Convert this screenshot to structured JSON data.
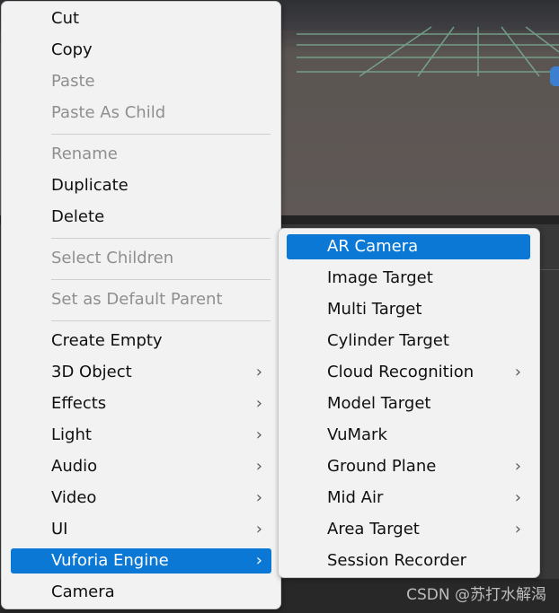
{
  "main_menu": {
    "items": [
      {
        "label": "Cut",
        "state": "enabled",
        "submenu": false
      },
      {
        "label": "Copy",
        "state": "enabled",
        "submenu": false
      },
      {
        "label": "Paste",
        "state": "disabled",
        "submenu": false
      },
      {
        "label": "Paste As Child",
        "state": "disabled",
        "submenu": false
      },
      {
        "label": "Rename",
        "state": "disabled",
        "submenu": false
      },
      {
        "label": "Duplicate",
        "state": "enabled",
        "submenu": false
      },
      {
        "label": "Delete",
        "state": "enabled",
        "submenu": false
      },
      {
        "label": "Select Children",
        "state": "disabled",
        "submenu": false
      },
      {
        "label": "Set as Default Parent",
        "state": "disabled",
        "submenu": false
      },
      {
        "label": "Create Empty",
        "state": "enabled",
        "submenu": false
      },
      {
        "label": "3D Object",
        "state": "enabled",
        "submenu": true
      },
      {
        "label": "Effects",
        "state": "enabled",
        "submenu": true
      },
      {
        "label": "Light",
        "state": "enabled",
        "submenu": true
      },
      {
        "label": "Audio",
        "state": "enabled",
        "submenu": true
      },
      {
        "label": "Video",
        "state": "enabled",
        "submenu": true
      },
      {
        "label": "UI",
        "state": "enabled",
        "submenu": true
      },
      {
        "label": "Vuforia Engine",
        "state": "selected",
        "submenu": true
      },
      {
        "label": "Camera",
        "state": "enabled",
        "submenu": false
      }
    ]
  },
  "sub_menu": {
    "items": [
      {
        "label": "AR Camera",
        "state": "selected",
        "submenu": false
      },
      {
        "label": "Image Target",
        "state": "enabled",
        "submenu": false
      },
      {
        "label": "Multi Target",
        "state": "enabled",
        "submenu": false
      },
      {
        "label": "Cylinder Target",
        "state": "enabled",
        "submenu": false
      },
      {
        "label": "Cloud Recognition",
        "state": "enabled",
        "submenu": true
      },
      {
        "label": "Model Target",
        "state": "enabled",
        "submenu": false
      },
      {
        "label": "VuMark",
        "state": "enabled",
        "submenu": false
      },
      {
        "label": "Ground Plane",
        "state": "enabled",
        "submenu": true
      },
      {
        "label": "Mid Air",
        "state": "enabled",
        "submenu": true
      },
      {
        "label": "Area Target",
        "state": "enabled",
        "submenu": true
      },
      {
        "label": "Session Recorder",
        "state": "enabled",
        "submenu": false
      }
    ]
  },
  "icons": {
    "submenu_arrow": "chevron-right-icon",
    "submenu_arrow_glyph": "›"
  },
  "watermark": "CSDN @苏打水解渴",
  "colors": {
    "highlight": "#0a78d4",
    "menu_bg": "#f2f2f2",
    "disabled_text": "#8f8f8f"
  }
}
